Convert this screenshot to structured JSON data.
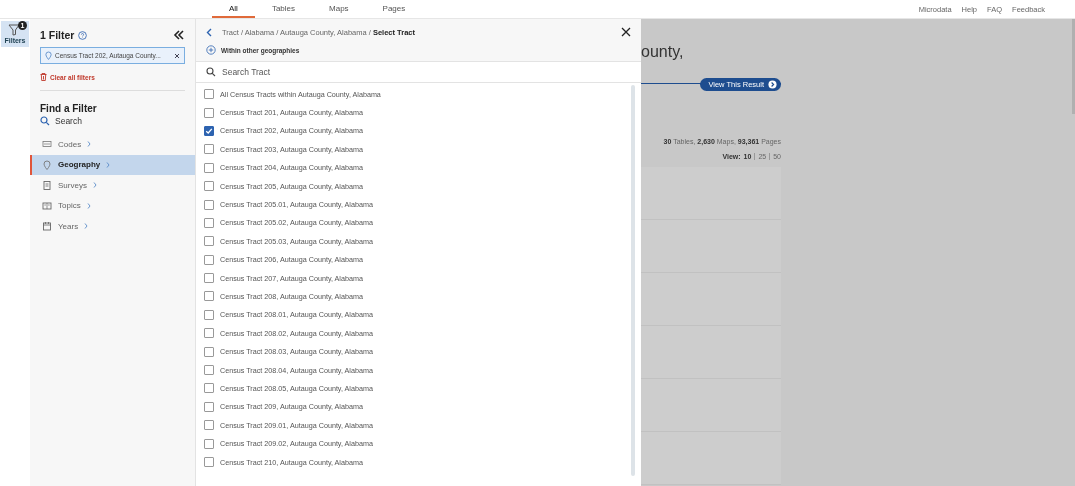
{
  "nav_tabs": [
    {
      "label": "All",
      "selected": true
    },
    {
      "label": "Tables",
      "selected": false
    },
    {
      "label": "Maps",
      "selected": false
    },
    {
      "label": "Pages",
      "selected": false
    }
  ],
  "top_links": [
    "Microdata",
    "Help",
    "FAQ",
    "Feedback"
  ],
  "rail": {
    "label": "Filters",
    "badge": "1"
  },
  "sidebar": {
    "title": "1 Filter",
    "chip": "Census Tract 202, Autauga County...",
    "clear": "Clear all filters",
    "find_heading": "Find a Filter",
    "search": "Search",
    "items": [
      {
        "kind": "codes",
        "label": "Codes",
        "selected": false
      },
      {
        "kind": "geography",
        "label": "Geography",
        "selected": true
      },
      {
        "kind": "surveys",
        "label": "Surveys",
        "selected": false
      },
      {
        "kind": "topics",
        "label": "Topics",
        "selected": false
      },
      {
        "kind": "years",
        "label": "Years",
        "selected": false
      }
    ]
  },
  "modal": {
    "breadcrumb": "Tract / Alabama / Autauga County, Alabama / **Select Tract**",
    "within": "Within other geographies",
    "search_placeholder": "Search Tract",
    "options": [
      {
        "label": "All Census Tracts within Autauga County, Alabama",
        "checked": false
      },
      {
        "label": "Census Tract 201, Autauga County, Alabama",
        "checked": false
      },
      {
        "label": "Census Tract 202, Autauga County, Alabama",
        "checked": true
      },
      {
        "label": "Census Tract 203, Autauga County, Alabama",
        "checked": false
      },
      {
        "label": "Census Tract 204, Autauga County, Alabama",
        "checked": false
      },
      {
        "label": "Census Tract 205, Autauga County, Alabama",
        "checked": false
      },
      {
        "label": "Census Tract 205.01, Autauga County, Alabama",
        "checked": false
      },
      {
        "label": "Census Tract 205.02, Autauga County, Alabama",
        "checked": false
      },
      {
        "label": "Census Tract 205.03, Autauga County, Alabama",
        "checked": false
      },
      {
        "label": "Census Tract 206, Autauga County, Alabama",
        "checked": false
      },
      {
        "label": "Census Tract 207, Autauga County, Alabama",
        "checked": false
      },
      {
        "label": "Census Tract 208, Autauga County, Alabama",
        "checked": false
      },
      {
        "label": "Census Tract 208.01, Autauga County, Alabama",
        "checked": false
      },
      {
        "label": "Census Tract 208.02, Autauga County, Alabama",
        "checked": false
      },
      {
        "label": "Census Tract 208.03, Autauga County, Alabama",
        "checked": false
      },
      {
        "label": "Census Tract 208.04, Autauga County, Alabama",
        "checked": false
      },
      {
        "label": "Census Tract 208.05, Autauga County, Alabama",
        "checked": false
      },
      {
        "label": "Census Tract 209, Autauga County, Alabama",
        "checked": false
      },
      {
        "label": "Census Tract 209.01, Autauga County, Alabama",
        "checked": false
      },
      {
        "label": "Census Tract 209.02, Autauga County, Alabama",
        "checked": false
      },
      {
        "label": "Census Tract 210, Autauga County, Alabama",
        "checked": false
      }
    ]
  },
  "background": {
    "heading": "ounty,",
    "result_button": "View This Result",
    "counts": "**30** Tables, **2,630** Maps, **93,361** Pages",
    "view_label": "View:",
    "view_options": [
      {
        "label": "10",
        "selected": true
      },
      {
        "label": "25",
        "selected": false
      },
      {
        "label": "50",
        "selected": false
      }
    ]
  }
}
